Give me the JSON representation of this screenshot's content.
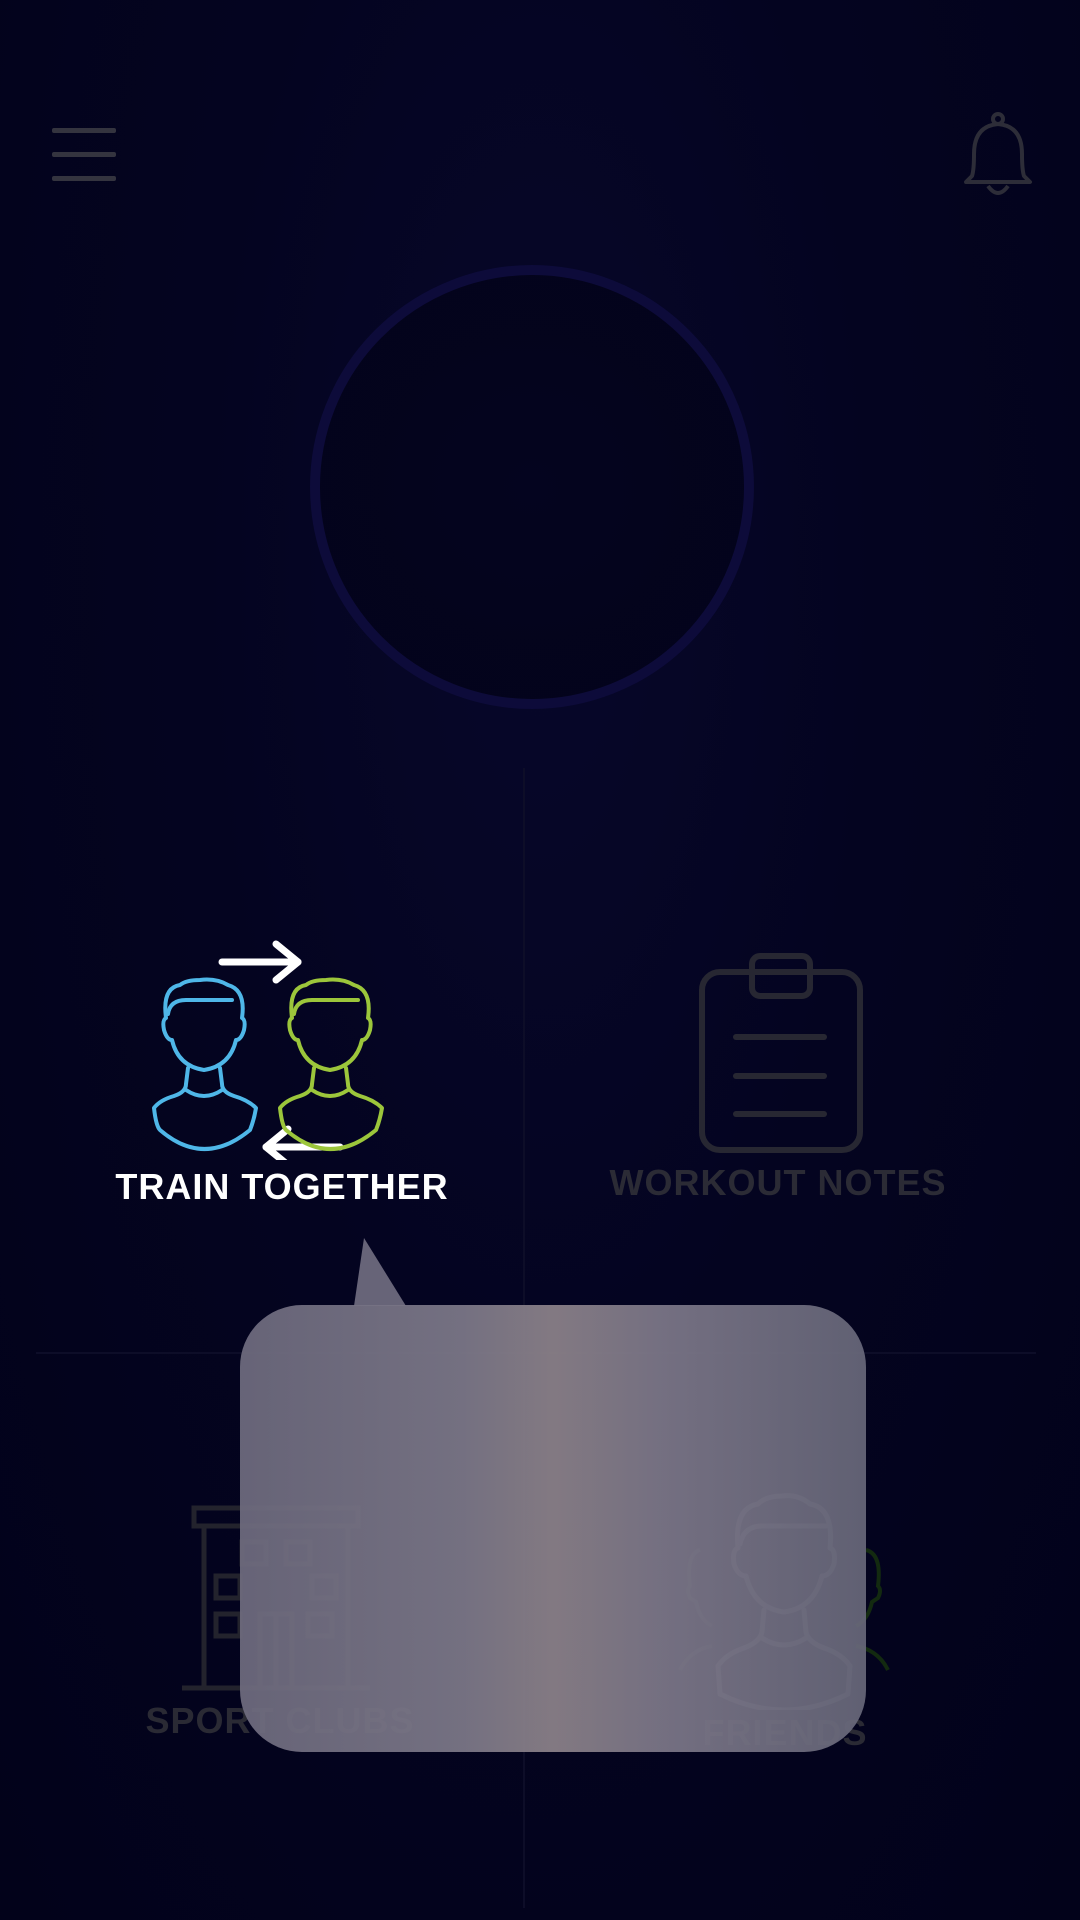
{
  "header": {
    "menu_icon": "hamburger-menu-icon",
    "notifications_icon": "bell-icon"
  },
  "profile": {
    "ring_color": "#0d0b3a"
  },
  "tiles": {
    "train_together": {
      "label": "TRAIN TOGETHER",
      "icon": "two-people-swap-icon",
      "state": "highlighted"
    },
    "workout_notes": {
      "label": "WORKOUT NOTES",
      "icon": "clipboard-icon",
      "state": "dimmed"
    },
    "sport_clubs": {
      "label": "SPORT CLUBS",
      "icon": "building-icon",
      "state": "dimmed"
    },
    "friends": {
      "label": "FRIENDS",
      "icon": "friends-icon",
      "state": "dimmed"
    }
  },
  "tooltip": {
    "text": ""
  },
  "colors": {
    "background": "#03031a",
    "accent_blue": "#4fb7e8",
    "accent_green": "#9cc63b",
    "active_label": "#ffffff",
    "dim_label": "#2b2b35",
    "tooltip_bg": "#7a7686"
  }
}
